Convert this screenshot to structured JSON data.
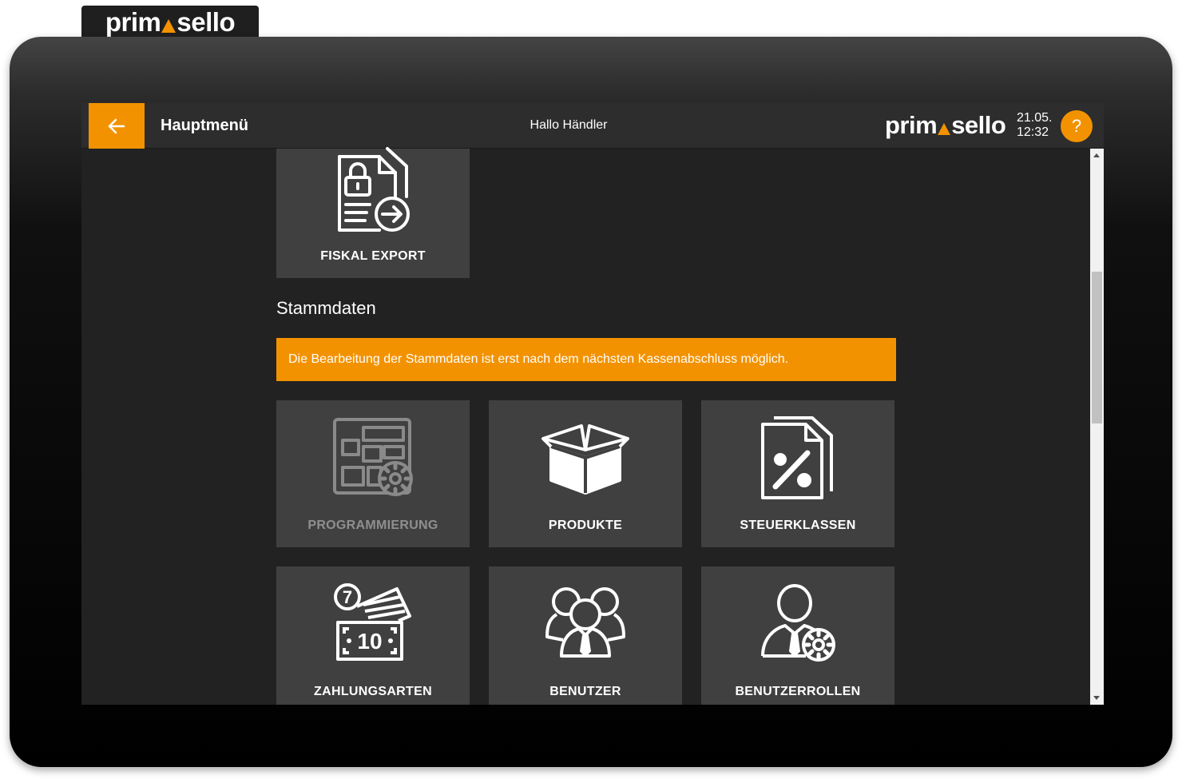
{
  "brand": {
    "prefix": "prim",
    "suffix": "sello",
    "accent": "#f39200"
  },
  "header": {
    "title": "Hauptmenü",
    "greeting": "Hallo Händler",
    "date": "21.05.",
    "time": "12:32",
    "help_label": "?"
  },
  "fiskal_tile": {
    "label": "FISKAL EXPORT"
  },
  "stammdaten": {
    "title": "Stammdaten",
    "notice": "Die Bearbeitung der Stammdaten ist erst nach dem nächsten Kassenabschluss möglich.",
    "tiles": [
      {
        "label": "PROGRAMMIERUNG",
        "icon": "programming-grid-icon",
        "enabled": false
      },
      {
        "label": "PRODUKTE",
        "icon": "box-icon",
        "enabled": true
      },
      {
        "label": "STEUERKLASSEN",
        "icon": "percent-document-icon",
        "enabled": true
      },
      {
        "label": "ZAHLUNGSARTEN",
        "icon": "cash-cards-icon",
        "enabled": true
      },
      {
        "label": "BENUTZER",
        "icon": "users-icon",
        "enabled": true
      },
      {
        "label": "BENUTZERROLLEN",
        "icon": "user-gear-icon",
        "enabled": true
      }
    ],
    "cash_icon_text": {
      "coin": "7",
      "note": "10"
    }
  }
}
